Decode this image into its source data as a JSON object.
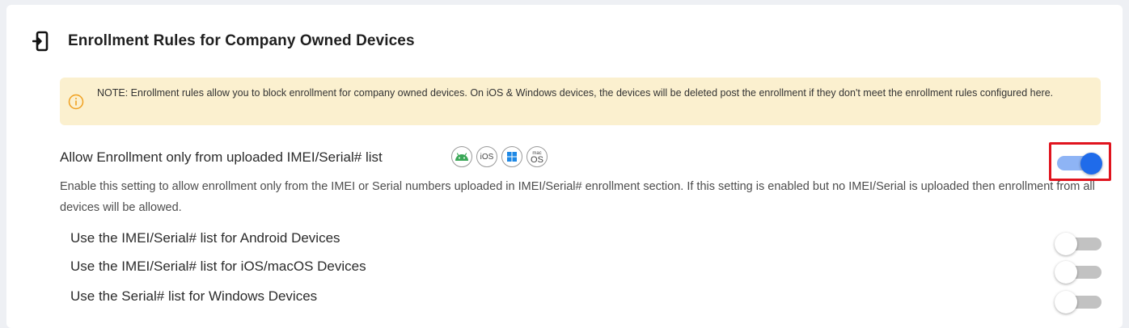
{
  "section": {
    "title": "Enrollment Rules for Company Owned Devices",
    "icon": "device-enroll-icon"
  },
  "note": {
    "icon": "info-icon",
    "text": "NOTE: Enrollment rules allow you to block enrollment for company owned devices. On iOS & Windows devices, the devices will be deleted post the enrollment if they don't meet the enrollment rules configured here."
  },
  "main_setting": {
    "label": "Allow Enrollment only from uploaded IMEI/Serial# list",
    "enabled": true,
    "description": "Enable this setting to allow enrollment only from the IMEI or Serial numbers uploaded in IMEI/Serial# enrollment section. If this setting is enabled but no IMEI/Serial is uploaded then enrollment from all devices will be allowed.",
    "platforms": [
      {
        "name": "android-icon"
      },
      {
        "name": "ios-icon",
        "label": "iOS"
      },
      {
        "name": "windows-icon"
      },
      {
        "name": "macos-icon",
        "label_small": "mac",
        "label": "OS"
      }
    ]
  },
  "sub_settings": [
    {
      "label": "Use the IMEI/Serial# list for Android Devices",
      "enabled": false
    },
    {
      "label": "Use the IMEI/Serial# list for iOS/macOS Devices",
      "enabled": false
    },
    {
      "label": "Use the Serial# list for Windows Devices",
      "enabled": false
    }
  ],
  "colors": {
    "accent": "#1f6bea",
    "note_bg": "#fbf0cf",
    "highlight": "#e0141e",
    "info_icon": "#f0a020"
  }
}
